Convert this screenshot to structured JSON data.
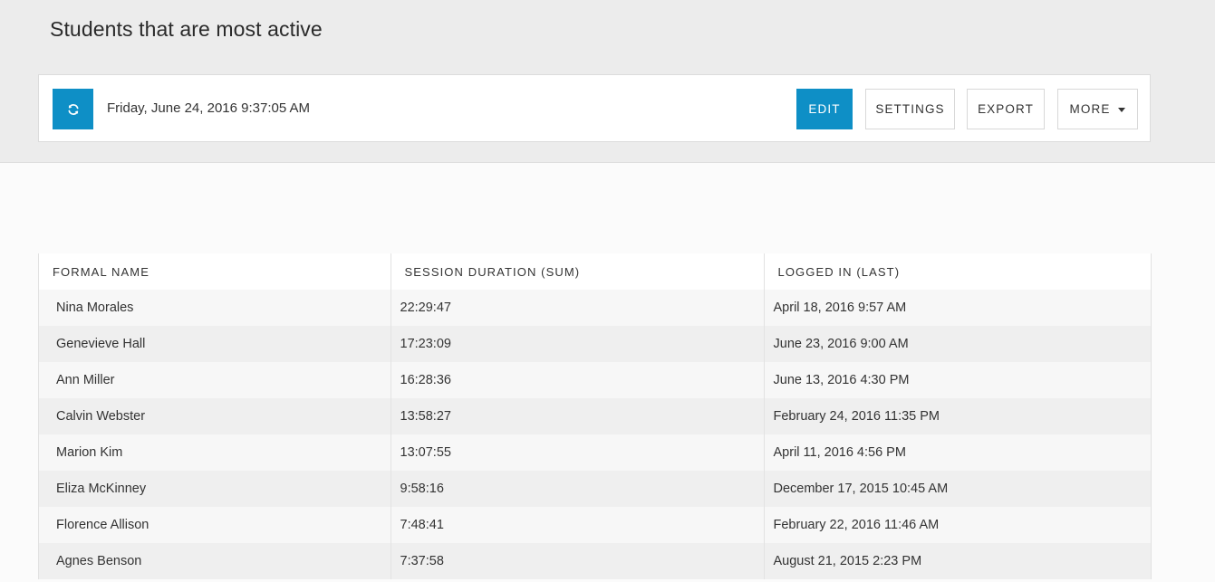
{
  "page": {
    "title": "Students that are most active"
  },
  "toolbar": {
    "refresh_icon": "refresh-icon",
    "timestamp": "Friday, June 24, 2016 9:37:05 AM",
    "edit_label": "EDIT",
    "settings_label": "SETTINGS",
    "export_label": "EXPORT",
    "more_label": "MORE",
    "accent_color": "#0e8fc6"
  },
  "table": {
    "columns": [
      "FORMAL NAME",
      "SESSION DURATION (SUM)",
      "LOGGED IN (LAST)"
    ],
    "rows": [
      [
        "Nina Morales",
        "22:29:47",
        "April 18, 2016 9:57 AM"
      ],
      [
        "Genevieve Hall",
        "17:23:09",
        "June 23, 2016 9:00 AM"
      ],
      [
        "Ann Miller",
        "16:28:36",
        "June 13, 2016 4:30 PM"
      ],
      [
        "Calvin Webster",
        "13:58:27",
        "February 24, 2016 11:35 PM"
      ],
      [
        "Marion Kim",
        "13:07:55",
        "April 11, 2016 4:56 PM"
      ],
      [
        "Eliza McKinney",
        "9:58:16",
        "December 17, 2015 10:45 AM"
      ],
      [
        "Florence Allison",
        "7:48:41",
        "February 22, 2016 11:46 AM"
      ],
      [
        "Agnes Benson",
        "7:37:58",
        "August 21, 2015 2:23 PM"
      ]
    ]
  }
}
